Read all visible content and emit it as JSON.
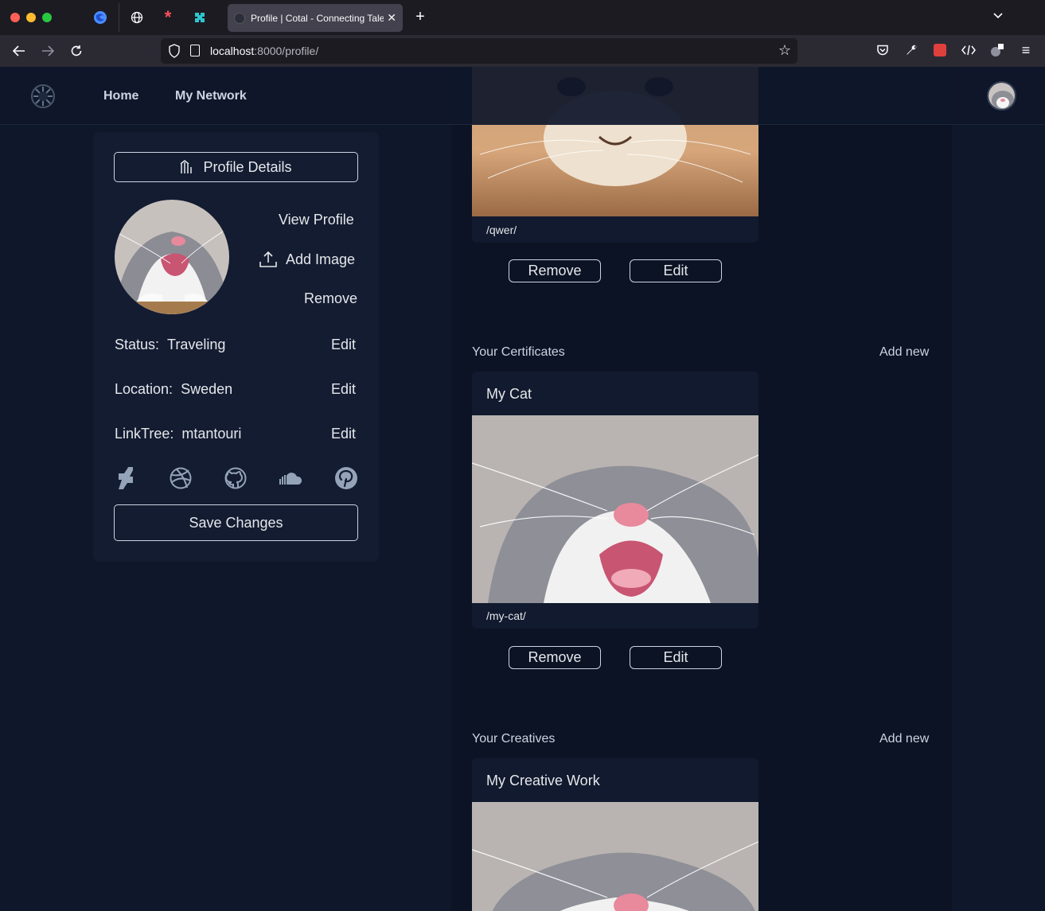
{
  "browser": {
    "tab_title": "Profile | Cotal - Connecting Tale",
    "url_host": "localhost",
    "url_path": ":8000/profile/"
  },
  "app_nav": {
    "home": "Home",
    "network": "My Network"
  },
  "profile": {
    "details_button": "Profile Details",
    "view_profile": "View Profile",
    "add_image": "Add Image",
    "remove": "Remove",
    "status_label": "Status:",
    "status_value": "Traveling",
    "location_label": "Location:",
    "location_value": "Sweden",
    "linktree_label": "LinkTree:",
    "linktree_value": "mtantouri",
    "edit": "Edit",
    "save_button": "Save Changes",
    "socials": [
      "deviantart-icon",
      "dribbble-icon",
      "github-icon",
      "soundcloud-icon",
      "pinterest-icon"
    ]
  },
  "projects": {
    "first_slug": "/qwer/",
    "remove": "Remove",
    "edit": "Edit"
  },
  "certificates": {
    "section_title": "Your Certificates",
    "add_new": "Add new",
    "card_title": "My Cat",
    "card_slug": "/my-cat/",
    "remove": "Remove",
    "edit": "Edit"
  },
  "creatives": {
    "section_title": "Your Creatives",
    "add_new": "Add new",
    "card_title": "My Creative Work"
  }
}
